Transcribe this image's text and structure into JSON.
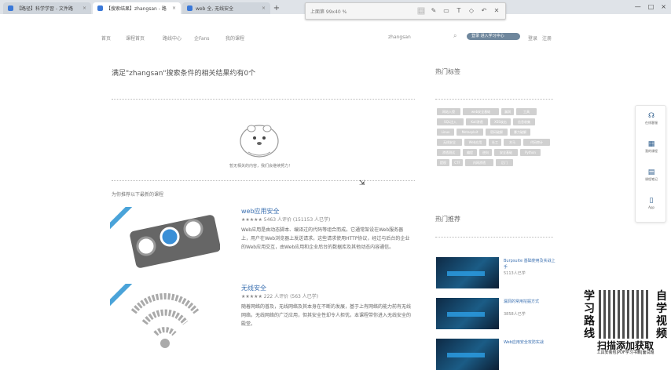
{
  "browser": {
    "tabs": [
      {
        "label": "【路径】科学学習 - 文件路",
        "active": false
      },
      {
        "label": "【搜索结果】zhangsan - 路",
        "active": true
      },
      {
        "label": "web 全, 无线安全",
        "active": false
      }
    ],
    "new_tab": "+",
    "window_controls": [
      "—",
      "□",
      "×"
    ]
  },
  "capture_toolbar": {
    "title": "上面第 99x40 %",
    "tools": [
      "select-icon",
      "pen-icon",
      "rect-icon",
      "text-icon",
      "eraser-icon",
      "undo-icon",
      "delete-icon"
    ]
  },
  "nav": {
    "links": [
      "首页",
      "课程首页",
      "路线中心",
      "企Fans",
      "我的课程"
    ],
    "username": "zhangsan",
    "pill": "登录 进入学习中心",
    "right": [
      "登录",
      "注册"
    ]
  },
  "search": {
    "result_title": "满足\"zhangsan\"搜索条件的相关结果约有0个",
    "empty_text": "暂无相关的内容，我们会继续努力！",
    "recommend_label": "为你推荐以下最新的课程"
  },
  "courses": [
    {
      "title": "web应用安全",
      "meta": "★★★★★ 5463 人评价 (151153 人已学)",
      "desc": "Web应用是由动态脚本、编译过的代码等组合而成。它通常架设在Web服务器上，用户在Web浏览器上发送请求，这些请求使用HTTP协议，经过与后台的企业的Web应用交互，由Web应用和企业后台的数据库及其他动态内容通信。",
      "label": "W W W"
    },
    {
      "title": "无线安全",
      "meta": "★★★★★ 222 人评价 (563 人已学)",
      "desc": "随着网络的普及，无线网络及其本身在不断的发展，基于上有网络的能力前有无线网络。无线网络的广泛应用，但其安全性却令人担忧。本课程带你进入无线安全的殿堂。",
      "label": "WiFi"
    }
  ],
  "sidebar": {
    "tags_heading": "热门标签",
    "tags": [
      "网站入侵",
      "web安全基础",
      "漏洞",
      "工具",
      "SQL注入",
      "Kali渗透",
      "XSS攻击",
      "信息收集",
      "Linux",
      "Metasploit",
      "密码破解",
      "暴力破解",
      "无线安全",
      "Web应用",
      "社工",
      "木马",
      "代码审计",
      "渗透测试",
      "编程",
      "逆向",
      "安全基础",
      "Python",
      "提权",
      "CTF",
      "内网渗透",
      "后门"
    ],
    "hot_heading": "热门推荐",
    "hot_items": [
      {
        "title": "Burpsuite 基础使用及实战上手",
        "count": "5113人已学"
      },
      {
        "title": "漏洞的常用挖掘方式",
        "count": "3858人已学"
      },
      {
        "title": "Web应用安全攻防实战",
        "count": "..."
      }
    ]
  },
  "float_panel": [
    {
      "icon": "headset-icon",
      "label": "在线客服"
    },
    {
      "icon": "calendar-icon",
      "label": "我的课程"
    },
    {
      "icon": "note-icon",
      "label": "课程笔记"
    },
    {
      "icon": "phone-icon",
      "label": "App"
    }
  ],
  "ad": {
    "left_chars": [
      "学",
      "习",
      "路",
      "线"
    ],
    "right_chars": [
      "自",
      "学",
      "视",
      "频"
    ],
    "cta": "扫描添加获取",
    "small": "工具安装包|PDF学习书籍|面试题"
  }
}
